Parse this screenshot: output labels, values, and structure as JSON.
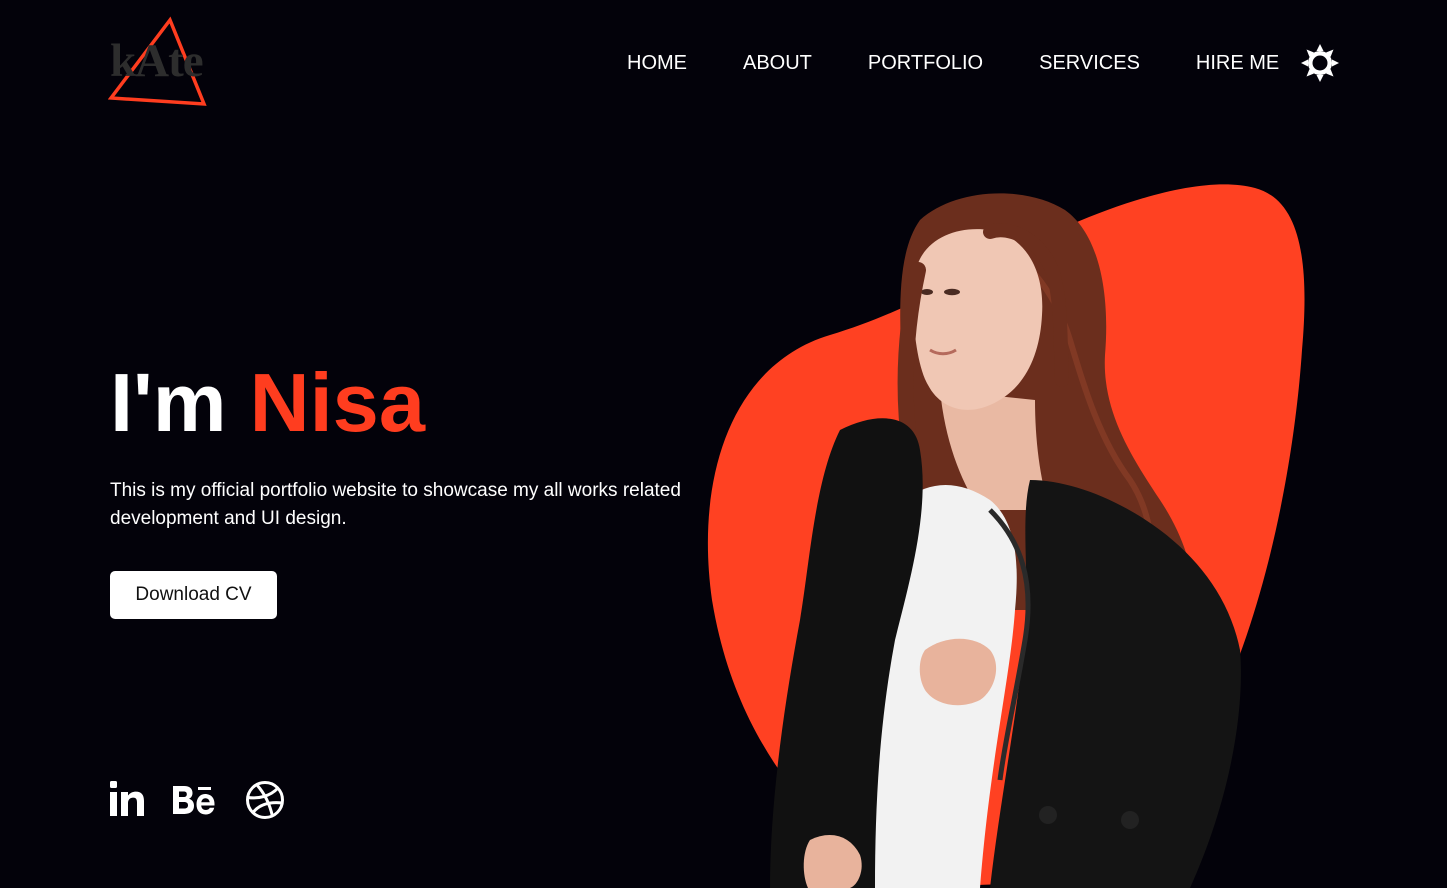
{
  "logo": {
    "text": "kAte",
    "alt": "kAte logo"
  },
  "nav": {
    "items": [
      {
        "label": "HOME"
      },
      {
        "label": "ABOUT"
      },
      {
        "label": "PORTFOLIO"
      },
      {
        "label": "SERVICES"
      },
      {
        "label": "HIRE ME"
      }
    ],
    "theme_toggle_icon": "sun-icon"
  },
  "hero": {
    "greeting": "I'm",
    "name": "Nisa",
    "description": "This is my official portfolio website to showcase my all works related development and UI design.",
    "cta_label": "Download CV"
  },
  "social": [
    {
      "icon": "linkedin-icon",
      "label": "in"
    },
    {
      "icon": "behance-icon",
      "label": "Bē"
    },
    {
      "icon": "dribbble-icon"
    }
  ],
  "colors": {
    "background": "#03020a",
    "accent": "#ff3d1f",
    "text": "#ffffff",
    "button_bg": "#ffffff",
    "logo_text": "#2d2d2d"
  }
}
